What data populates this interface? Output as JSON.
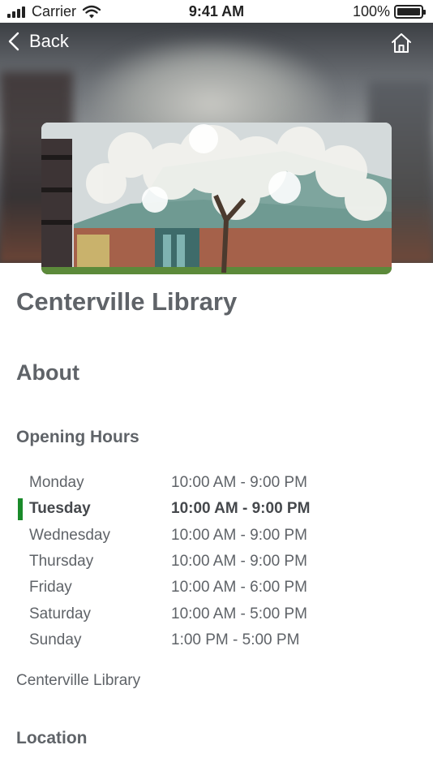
{
  "status_bar": {
    "carrier": "Carrier",
    "time": "9:41 AM",
    "battery": "100%",
    "signal_icon": "cellular-signal-icon",
    "wifi_icon": "wifi-icon",
    "battery_icon": "battery-icon"
  },
  "nav": {
    "back_label": "Back",
    "back_icon": "chevron-left-icon",
    "home_icon": "home-icon"
  },
  "library": {
    "name": "Centerville Library",
    "photo_subject": "library building with blossoming tree"
  },
  "sections": {
    "about": "About",
    "opening_hours": "Opening Hours",
    "location": "Location"
  },
  "hours": [
    {
      "day": "Monday",
      "time": "10:00 AM - 9:00 PM",
      "today": false
    },
    {
      "day": "Tuesday",
      "time": "10:00 AM - 9:00 PM",
      "today": true
    },
    {
      "day": "Wednesday",
      "time": "10:00 AM - 9:00 PM",
      "today": false
    },
    {
      "day": "Thursday",
      "time": "10:00 AM - 9:00 PM",
      "today": false
    },
    {
      "day": "Friday",
      "time": "10:00 AM - 6:00 PM",
      "today": false
    },
    {
      "day": "Saturday",
      "time": "10:00 AM - 5:00 PM",
      "today": false
    },
    {
      "day": "Sunday",
      "time": "1:00 PM - 5:00 PM",
      "today": false
    }
  ],
  "footer_name": "Centerville Library",
  "colors": {
    "today_marker": "#1a8a2a",
    "heading_text": "#5f6368"
  }
}
